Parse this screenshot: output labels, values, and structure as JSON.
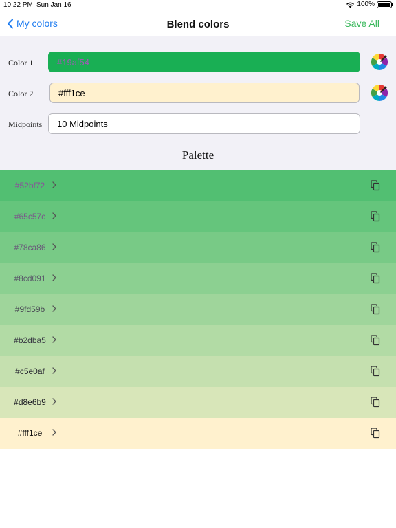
{
  "status": {
    "time": "10:22 PM",
    "date": "Sun Jan 16",
    "battery": "100%"
  },
  "nav": {
    "back_label": "My colors",
    "title": "Blend colors",
    "save_label": "Save All"
  },
  "form": {
    "color1": {
      "label": "Color 1",
      "value": "#19af54",
      "bg": "#19af54",
      "text_color": "#a05ab4"
    },
    "color2": {
      "label": "Color 2",
      "value": "#fff1ce",
      "bg": "#fff1ce",
      "text_color": "#000000"
    },
    "midpoints": {
      "label": "Midpoints",
      "value": "10 Midpoints"
    }
  },
  "palette": {
    "title": "Palette",
    "rows": [
      {
        "hex": "#52bf72",
        "color": "#52bf72",
        "text_color": "#8a4f9a"
      },
      {
        "hex": "#65c57c",
        "color": "#65c57c",
        "text_color": "#7a5a8a"
      },
      {
        "hex": "#78ca86",
        "color": "#78ca86",
        "text_color": "#6a5a7a"
      },
      {
        "hex": "#8cd091",
        "color": "#8cd091",
        "text_color": "#5a5a6a"
      },
      {
        "hex": "#9fd59b",
        "color": "#9fd59b",
        "text_color": "#4a4a55"
      },
      {
        "hex": "#b2dba5",
        "color": "#b2dba5",
        "text_color": "#3a3a44"
      },
      {
        "hex": "#c5e0af",
        "color": "#c5e0af",
        "text_color": "#2a2a33"
      },
      {
        "hex": "#d8e6b9",
        "color": "#d8e6b9",
        "text_color": "#1a1a22"
      },
      {
        "hex": "#fff1ce",
        "color": "#fff1ce",
        "text_color": "#111111"
      }
    ]
  }
}
